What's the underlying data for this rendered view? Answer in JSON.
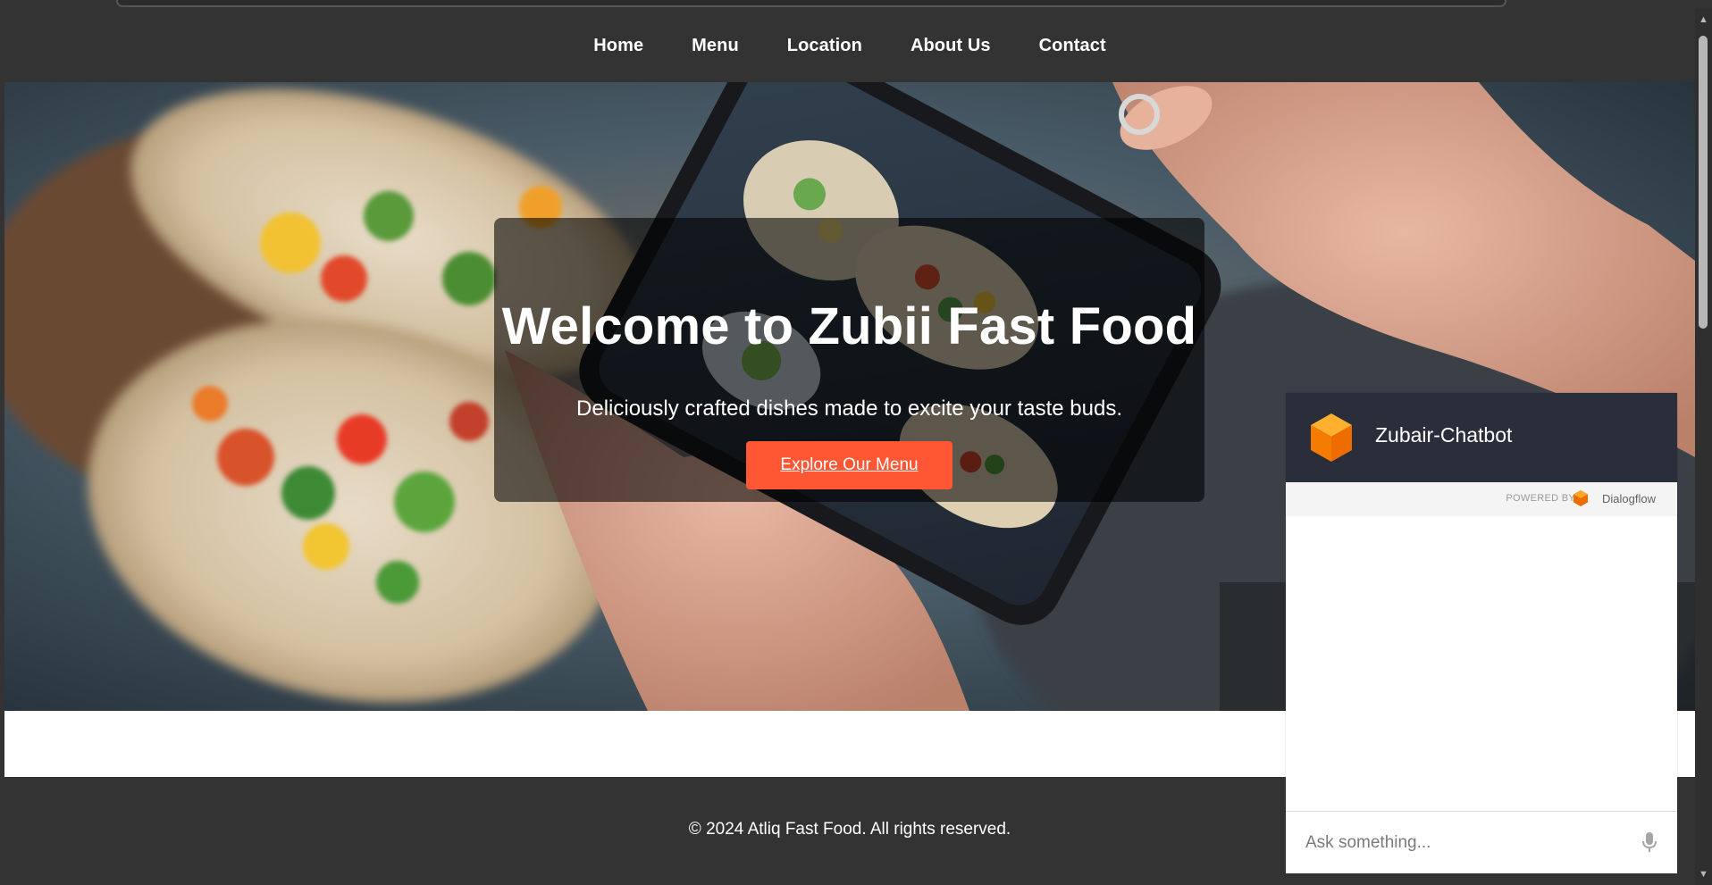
{
  "nav": {
    "items": [
      {
        "label": "Home"
      },
      {
        "label": "Menu"
      },
      {
        "label": "Location"
      },
      {
        "label": "About Us"
      },
      {
        "label": "Contact"
      }
    ]
  },
  "hero": {
    "title": "Welcome to Zubii Fast Food",
    "subtitle": "Deliciously crafted dishes made to excite your taste buds.",
    "cta_label": "Explore Our Menu"
  },
  "footer": {
    "copyright": "© 2024 Atliq Fast Food. All rights reserved."
  },
  "chatbot": {
    "title": "Zubair-Chatbot",
    "powered_by": "POWERED BY",
    "brand": "Dialogflow",
    "input_placeholder": "Ask something..."
  },
  "icons": {
    "chat_avatar": "orange-cube-icon",
    "dialogflow_logo": "dialogflow-logo",
    "mic": "microphone-icon",
    "scroll_up": "chevron-up-icon",
    "scroll_down": "chevron-down-icon"
  },
  "colors": {
    "accent": "#ff5733",
    "nav_bg": "#333333",
    "chat_header": "#2a2d3a",
    "chat_avatar": "#f5a623"
  }
}
